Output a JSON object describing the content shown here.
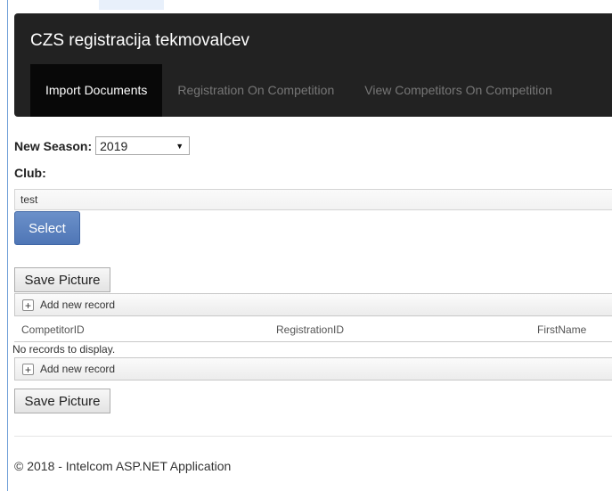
{
  "navbar": {
    "brand": "CZS registracija tekmovalcev",
    "tabs": [
      {
        "label": "Import Documents",
        "active": true
      },
      {
        "label": "Registration On Competition",
        "active": false
      },
      {
        "label": "View Competitors On Competition",
        "active": false
      }
    ]
  },
  "form": {
    "season_label": "New Season:",
    "season_value": "2019",
    "club_label": "Club:",
    "club_value": "test",
    "select_button": "Select"
  },
  "actions": {
    "save_picture_label": "Save Picture"
  },
  "grid": {
    "add_new_record_label": "Add new record",
    "columns": [
      "CompetitorID",
      "RegistrationID",
      "FirstName"
    ],
    "empty_text": "No records to display."
  },
  "footer": {
    "text": "© 2018 - Intelcom ASP.NET Application"
  },
  "colors": {
    "navbar_bg": "#222222",
    "active_tab_bg": "#080808",
    "primary_button": "#5b7fbf"
  },
  "icons": {
    "select_caret": "caret-down-icon",
    "add_record": "plus-icon"
  }
}
